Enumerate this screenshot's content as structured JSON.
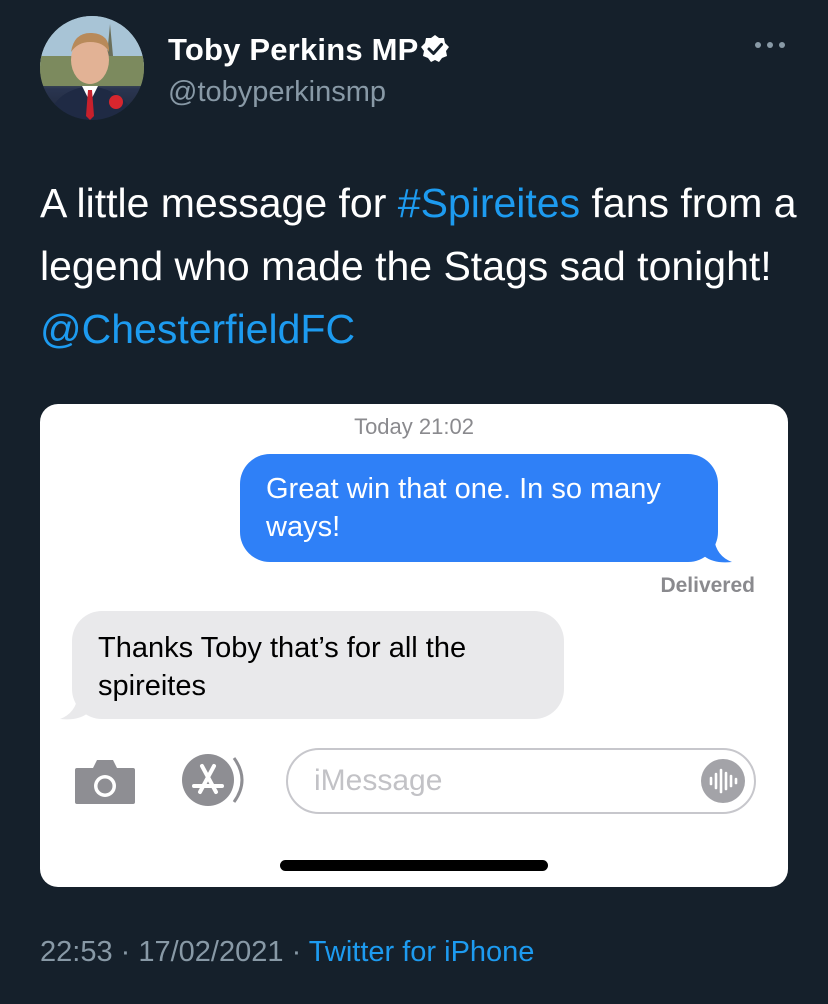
{
  "author": {
    "display_name": "Toby Perkins MP",
    "handle": "@tobyperkinsmp",
    "avatar_icon": "profile-photo",
    "verified_icon": "verified-badge-icon",
    "more_icon": "more-options-icon"
  },
  "tweet": {
    "text_part1": "A little message for ",
    "hashtag": "#Spireites",
    "text_part2": " fans from a legend who made the Stags sad tonight! ",
    "mention": "@ChesterfieldFC"
  },
  "imessage_screenshot": {
    "timestamp": "Today 21:02",
    "outgoing_message": "Great win that one. In so many ways!",
    "delivery_status": "Delivered",
    "incoming_message": "Thanks Toby that’s for all the spireites",
    "input_placeholder": "iMessage",
    "icons": [
      "camera-icon",
      "app-store-icon",
      "audio-message-icon"
    ]
  },
  "footer": {
    "time": "22:53",
    "separator1": " · ",
    "date": "17/02/2021",
    "separator2": " · ",
    "source": "Twitter for iPhone"
  },
  "colors": {
    "background": "#15202b",
    "link": "#1d9bf0",
    "secondary_text": "#8899a6",
    "imessage_blue": "#2f80f7",
    "imessage_gray": "#e9e9eb"
  }
}
